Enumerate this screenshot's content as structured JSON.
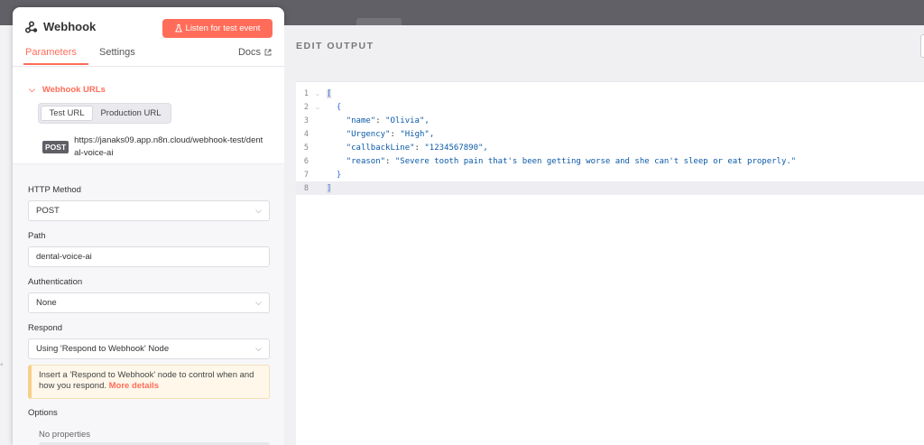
{
  "node": {
    "title": "Webhook",
    "listen_button": "Listen for test event",
    "tabs": {
      "parameters": "Parameters",
      "settings": "Settings",
      "docs": "Docs"
    }
  },
  "webhook_urls": {
    "heading": "Webhook URLs",
    "test_url_label": "Test URL",
    "production_url_label": "Production URL",
    "method_badge": "POST",
    "url": "https://janaks09.app.n8n.cloud/webhook-test/dental-voice-ai"
  },
  "fields": {
    "http_method": {
      "label": "HTTP Method",
      "value": "POST"
    },
    "path": {
      "label": "Path",
      "value": "dental-voice-ai"
    },
    "authentication": {
      "label": "Authentication",
      "value": "None"
    },
    "respond": {
      "label": "Respond",
      "value": "Using 'Respond to Webhook' Node"
    }
  },
  "notice": {
    "text": "Insert a 'Respond to Webhook' node to control when and how you respond.",
    "link": "More details"
  },
  "options": {
    "label": "Options",
    "empty": "No properties"
  },
  "output": {
    "heading": "EDIT OUTPUT",
    "lines": [
      {
        "num": "1",
        "text": "["
      },
      {
        "num": "2",
        "text": "{"
      },
      {
        "num": "3",
        "key": "\"name\"",
        "value": "\"Olivia\","
      },
      {
        "num": "4",
        "key": "\"Urgency\"",
        "value": "\"High\","
      },
      {
        "num": "5",
        "key": "\"callbackLine\"",
        "value": "\"1234567890\","
      },
      {
        "num": "6",
        "key": "\"reason\"",
        "value": "\"Severe tooth pain that's been getting worse and she can't sleep or eat properly.\""
      },
      {
        "num": "7",
        "text": "}"
      },
      {
        "num": "8",
        "text": "]"
      }
    ]
  },
  "colors": {
    "accent": "#ff6d5a",
    "json_string": "#0b5aa8",
    "bracket": "#3e6fd6"
  },
  "icons": [
    "webhook-icon",
    "flask-icon",
    "external-link-icon",
    "chevron-down-icon",
    "fold-arrow-icon"
  ]
}
